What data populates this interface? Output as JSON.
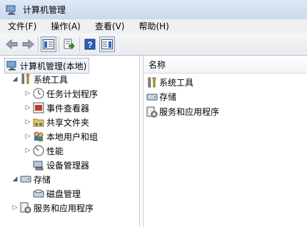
{
  "window": {
    "title": "计算机管理"
  },
  "menu": [
    {
      "label": "文件(F)"
    },
    {
      "label": "操作(A)"
    },
    {
      "label": "查看(V)"
    },
    {
      "label": "帮助(H)"
    }
  ],
  "toolbar": {
    "buttons": [
      "back-arrow-icon",
      "forward-arrow-icon",
      "show-hide-tree-icon",
      "export-list-icon",
      "help-icon",
      "show-hide-action-pane-icon"
    ]
  },
  "tree": {
    "root": "计算机管理(本地)",
    "system_tools": "系统工具",
    "task_scheduler": "任务计划程序",
    "event_viewer": "事件查看器",
    "shared_folders": "共享文件夹",
    "local_users": "本地用户和组",
    "performance": "性能",
    "device_manager": "设备管理器",
    "storage": "存储",
    "disk_management": "磁盘管理",
    "services_apps": "服务和应用程序"
  },
  "list": {
    "column_header": "名称",
    "items": [
      "系统工具",
      "存储",
      "服务和应用程序"
    ]
  },
  "colors": {
    "title_bar": "#d5e2f2",
    "tree_selection": "#eef3fa",
    "toolbar_bg": "#efefef"
  }
}
